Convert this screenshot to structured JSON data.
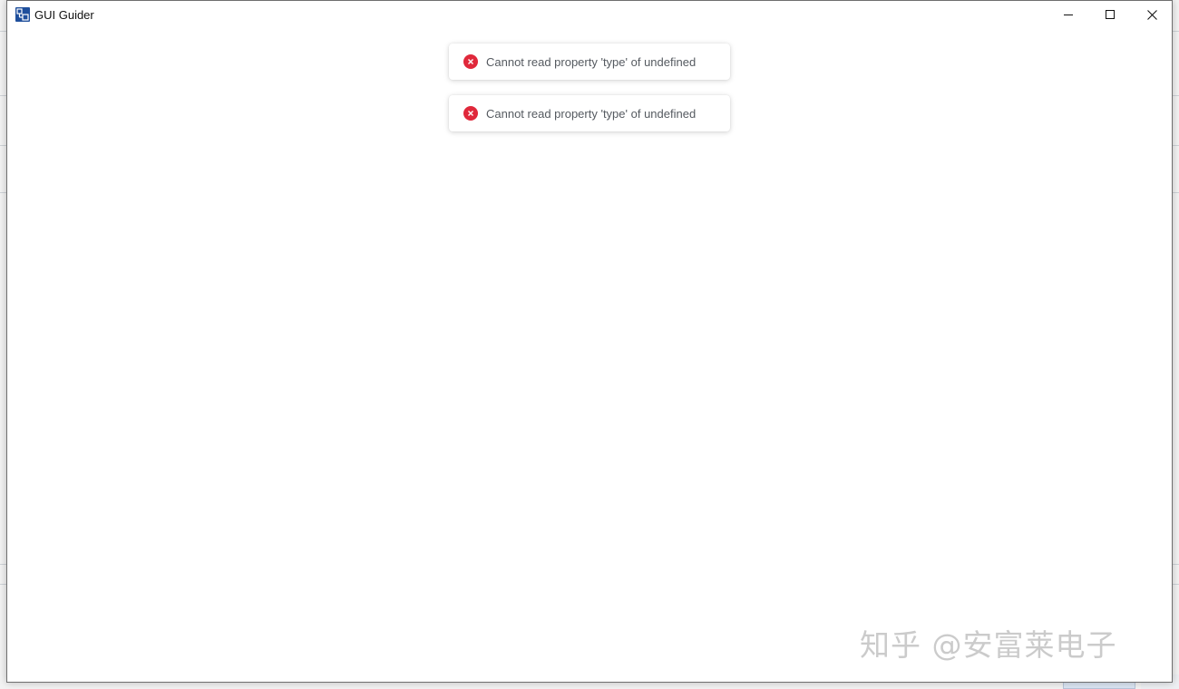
{
  "window": {
    "title": "GUI Guider",
    "buttons": {
      "minimize": "minimize",
      "maximize": "maximize",
      "close": "close"
    }
  },
  "toasts": [
    {
      "type": "error",
      "message": "Cannot read property 'type' of undefined"
    },
    {
      "type": "error",
      "message": "Cannot read property 'type' of undefined"
    }
  ],
  "watermark": "知乎 @安富莱电子",
  "colors": {
    "error": "#e0283b",
    "app_icon": "#1f4f9c",
    "toast_text": "#555a60"
  }
}
